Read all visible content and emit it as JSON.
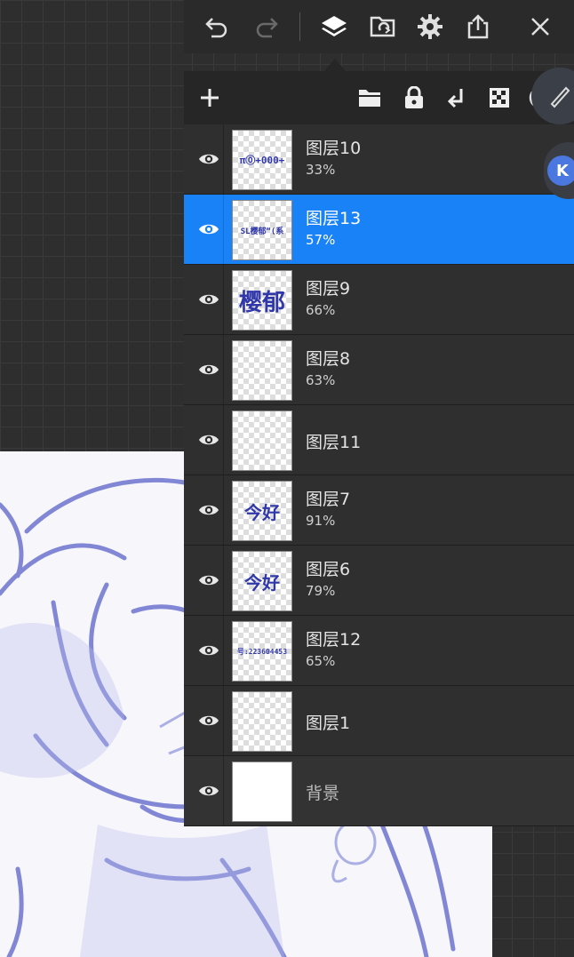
{
  "toolbar": {
    "icons": [
      "undo-icon",
      "redo-icon",
      "layers-icon",
      "import-icon",
      "settings-icon",
      "share-icon",
      "close-icon"
    ]
  },
  "panel_tools": {
    "icons": [
      "add-layer-icon",
      "folder-icon",
      "lock-icon",
      "merge-down-icon",
      "alpha-lock-icon",
      "reference-icon"
    ]
  },
  "side": {
    "badge_letter": "K"
  },
  "layers": [
    {
      "name": "图层10",
      "opacity": "33%",
      "thumb": "π⓪+000+",
      "thumb_size": 11,
      "selected": false
    },
    {
      "name": "图层13",
      "opacity": "57%",
      "thumb": "SL樱郁“(系",
      "thumb_size": 9,
      "selected": true
    },
    {
      "name": "图层9",
      "opacity": "66%",
      "thumb": "樱郁",
      "thumb_size": 26,
      "selected": false
    },
    {
      "name": "图层8",
      "opacity": "63%",
      "thumb": "",
      "thumb_size": 8,
      "selected": false
    },
    {
      "name": "图层11",
      "opacity": "",
      "thumb": "",
      "thumb_size": 8,
      "selected": false
    },
    {
      "name": "图层7",
      "opacity": "91%",
      "thumb": "今好",
      "thumb_size": 20,
      "selected": false
    },
    {
      "name": "图层6",
      "opacity": "79%",
      "thumb": "今好",
      "thumb_size": 20,
      "selected": false
    },
    {
      "name": "图层12",
      "opacity": "65%",
      "thumb": "号:223604453",
      "thumb_size": 8,
      "selected": false
    },
    {
      "name": "图层1",
      "opacity": "",
      "thumb": "",
      "thumb_size": 8,
      "selected": false
    }
  ],
  "background_layer": {
    "name": "背景"
  },
  "colors": {
    "accent": "#1a82f7",
    "ink": "#3037a8",
    "panel": "#262626"
  }
}
